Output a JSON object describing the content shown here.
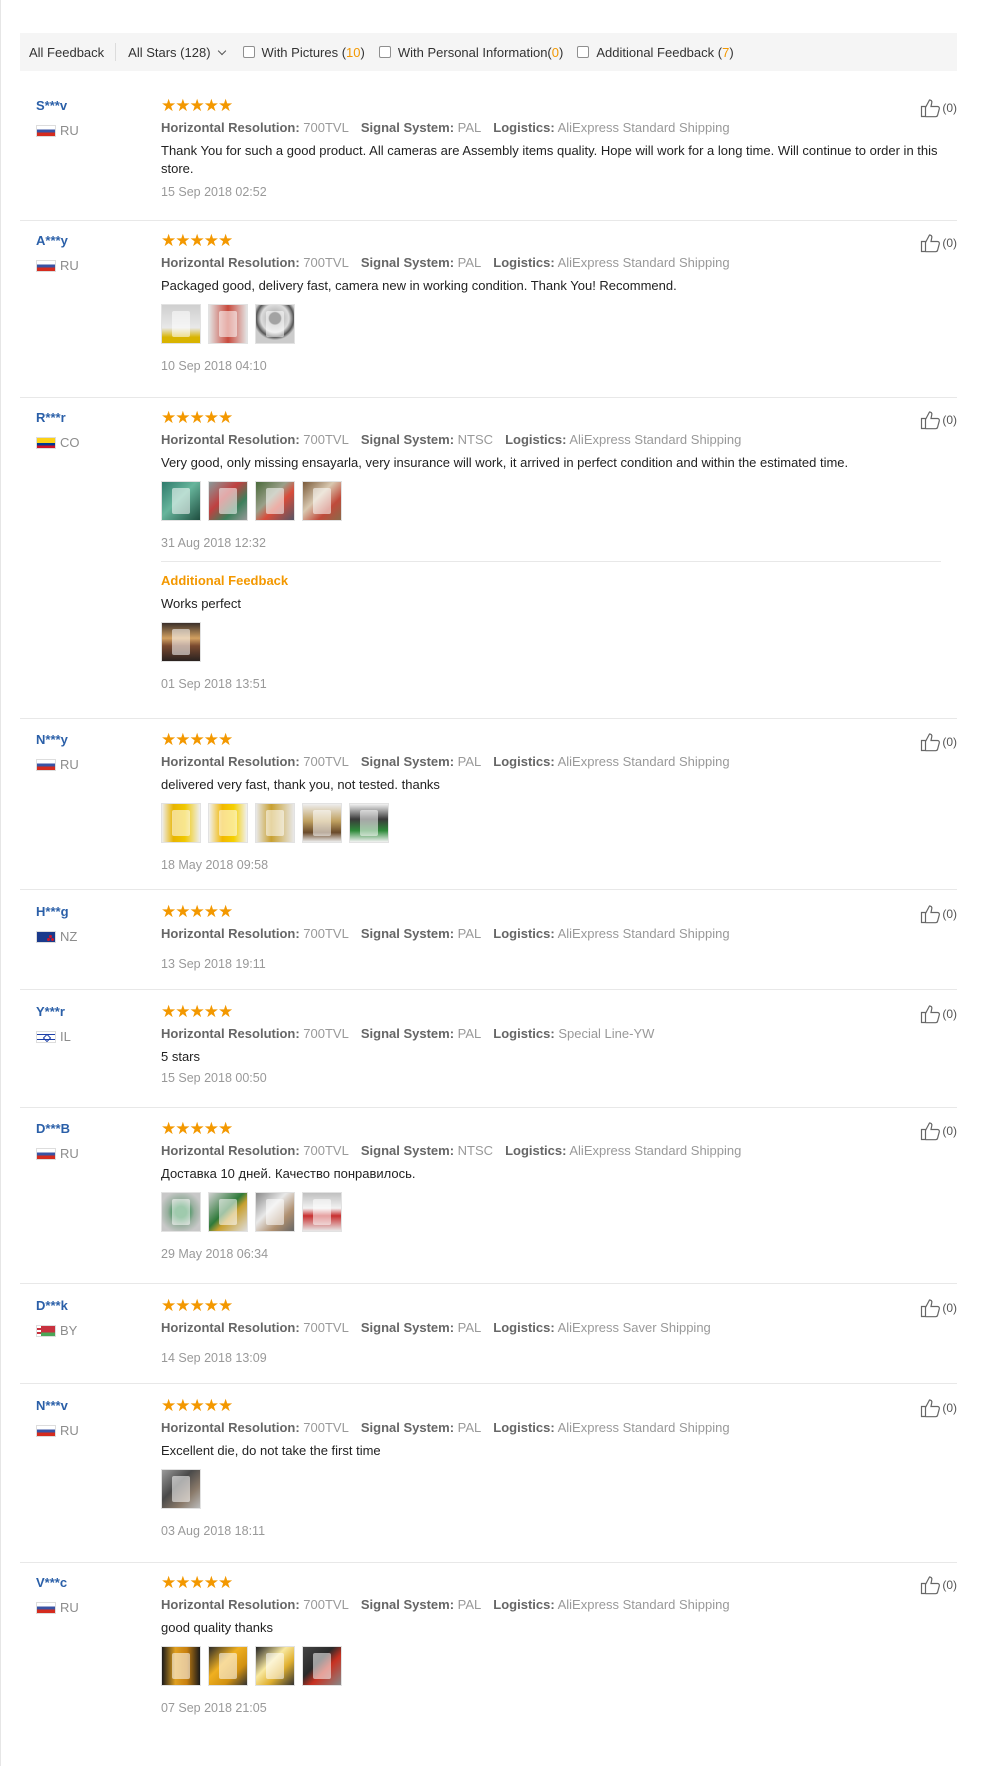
{
  "filters": {
    "all_feedback": "All Feedback",
    "all_stars": "All Stars (128)",
    "with_pictures_label": "With Pictures (",
    "with_pictures_count": "10",
    "with_personal_label": "With Personal Information(",
    "with_personal_count": "0",
    "additional_label": "Additional Feedback (",
    "additional_count": "7",
    "close_paren": ")"
  },
  "labels": {
    "resolution": "Horizontal Resolution:",
    "signal": "Signal System:",
    "logistics": "Logistics:",
    "additional_feedback": "Additional Feedback"
  },
  "stars_glyph": "★★★★★",
  "reviews": [
    {
      "user": "S***v",
      "country": "RU",
      "rating": 5,
      "resolution": "700TVL",
      "signal": "PAL",
      "logistics": "AliExpress Standard Shipping",
      "text": "Thank You for such a good product. All cameras are Assembly items quality. Hope will work for a long time. Will continue to order in this store.",
      "date": "15 Sep 2018 02:52",
      "likes": "(0)"
    },
    {
      "user": "A***y",
      "country": "RU",
      "rating": 5,
      "resolution": "700TVL",
      "signal": "PAL",
      "logistics": "AliExpress Standard Shipping",
      "text": "Packaged good, delivery fast, camera new in working condition. Thank You! Recommend.",
      "date": "10 Sep 2018 04:10",
      "likes": "(0)"
    },
    {
      "user": "R***r",
      "country": "CO",
      "rating": 5,
      "resolution": "700TVL",
      "signal": "NTSC",
      "logistics": "AliExpress Standard Shipping",
      "text": "Very good, only missing ensayarla, very insurance will work, it arrived in perfect condition and within the estimated time.",
      "date": "31 Aug 2018 12:32",
      "likes": "(0)",
      "additional_text": "Works perfect",
      "additional_date": "01 Sep 2018 13:51"
    },
    {
      "user": "N***y",
      "country": "RU",
      "rating": 5,
      "resolution": "700TVL",
      "signal": "PAL",
      "logistics": "AliExpress Standard Shipping",
      "text": "delivered very fast, thank you, not tested. thanks",
      "date": "18 May 2018 09:58",
      "likes": "(0)"
    },
    {
      "user": "H***g",
      "country": "NZ",
      "rating": 5,
      "resolution": "700TVL",
      "signal": "PAL",
      "logistics": "AliExpress Standard Shipping",
      "date": "13 Sep 2018 19:11",
      "likes": "(0)"
    },
    {
      "user": "Y***r",
      "country": "IL",
      "rating": 5,
      "resolution": "700TVL",
      "signal": "PAL",
      "logistics": "Special Line-YW",
      "text": "5 stars",
      "date": "15 Sep 2018 00:50",
      "likes": "(0)"
    },
    {
      "user": "D***B",
      "country": "RU",
      "rating": 5,
      "resolution": "700TVL",
      "signal": "NTSC",
      "logistics": "AliExpress Standard Shipping",
      "text": "Доставка 10 дней. Качество понравилось.",
      "date": "29 May 2018 06:34",
      "likes": "(0)"
    },
    {
      "user": "D***k",
      "country": "BY",
      "rating": 5,
      "resolution": "700TVL",
      "signal": "PAL",
      "logistics": "AliExpress Saver Shipping",
      "date": "14 Sep 2018 13:09",
      "likes": "(0)"
    },
    {
      "user": "N***v",
      "country": "RU",
      "rating": 5,
      "resolution": "700TVL",
      "signal": "PAL",
      "logistics": "AliExpress Standard Shipping",
      "text": "Excellent die, do not take the first time",
      "date": "03 Aug 2018 18:11",
      "likes": "(0)"
    },
    {
      "user": "V***c",
      "country": "RU",
      "rating": 5,
      "resolution": "700TVL",
      "signal": "PAL",
      "logistics": "AliExpress Standard Shipping",
      "text": "good quality thanks",
      "date": "07 Sep 2018 21:05",
      "likes": "(0)"
    }
  ],
  "colors": {
    "accent": "#f39800",
    "username": "#2a5fa8",
    "meta": "#999999"
  },
  "icons": {
    "like": "thumbs-up-icon",
    "star": "star-icon",
    "dropdown": "chevron-down-icon"
  }
}
